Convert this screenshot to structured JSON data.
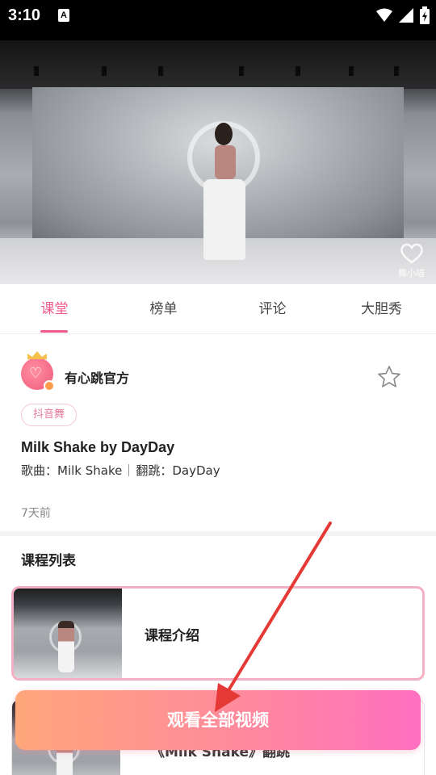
{
  "status_bar": {
    "time": "3:10",
    "indicator": "A"
  },
  "video": {
    "watermark": "舞小喵"
  },
  "tabs": [
    {
      "label": "课堂",
      "active": true
    },
    {
      "label": "榜单",
      "active": false
    },
    {
      "label": "评论",
      "active": false
    },
    {
      "label": "大胆秀",
      "active": false
    }
  ],
  "author": {
    "name": "有心跳官方",
    "avatar_icon": "heart-avatar-icon"
  },
  "tag": "抖音舞",
  "course": {
    "title": "Milk Shake by DayDay",
    "song_label": "歌曲：Milk Shake",
    "choreo_label": "翻跳：DayDay",
    "time_ago": "7天前"
  },
  "list": {
    "title": "课程列表",
    "items": [
      {
        "label": "课程介绍"
      },
      {
        "label": "《Milk Shake》翻跳"
      }
    ]
  },
  "cta": {
    "label": "观看全部视频"
  },
  "colors": {
    "accent": "#f05a8a",
    "tag_border": "#f3c9d6",
    "cta_start": "#ffa67a",
    "cta_end": "#ff6fc0",
    "arrow": "#e53935"
  }
}
